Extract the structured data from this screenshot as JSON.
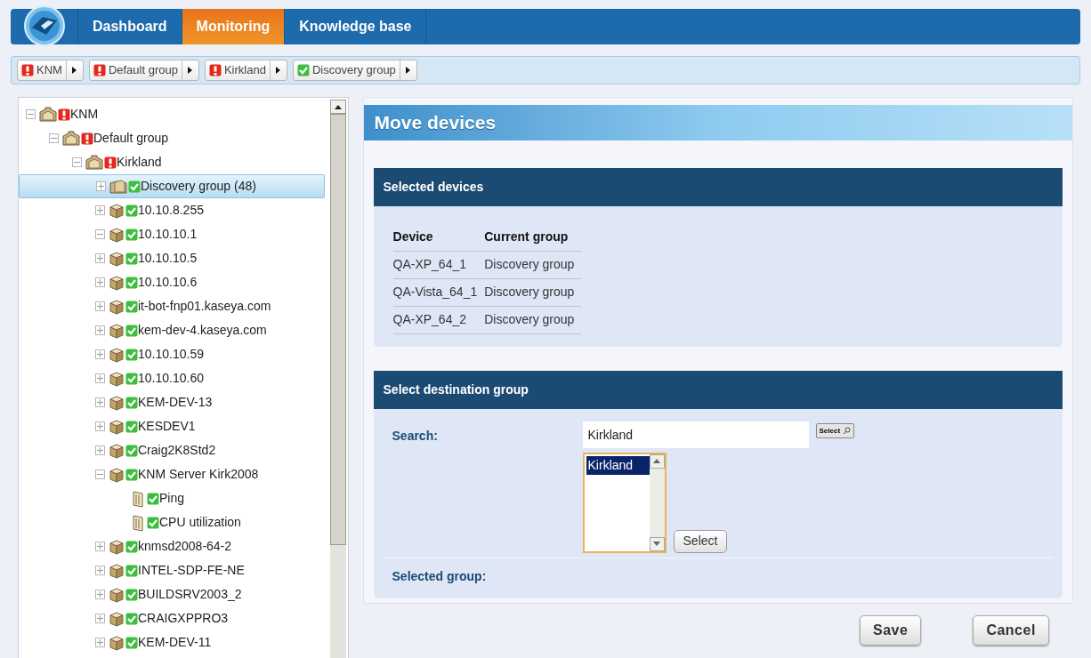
{
  "nav": {
    "tabs": [
      {
        "label": "Dashboard",
        "selected": false
      },
      {
        "label": "Monitoring",
        "selected": true
      },
      {
        "label": "Knowledge base",
        "selected": false
      }
    ]
  },
  "breadcrumb": [
    {
      "label": "KNM",
      "alert": true
    },
    {
      "label": "Default group",
      "alert": true
    },
    {
      "label": "Kirkland",
      "alert": true
    },
    {
      "label": "Discovery group",
      "alert": false
    }
  ],
  "tree": [
    {
      "label": "KNM",
      "kind": "group",
      "alert": true,
      "expanded": true,
      "selected": false,
      "children": [
        {
          "label": "Default group",
          "kind": "group",
          "alert": true,
          "expanded": true,
          "selected": false,
          "children": [
            {
              "label": "Kirkland",
              "kind": "group",
              "alert": true,
              "expanded": true,
              "selected": false,
              "children": [
                {
                  "label": "Discovery group (48)",
                  "kind": "folder",
                  "alert": false,
                  "expanded": false,
                  "selected": true
                },
                {
                  "label": "10.10.8.255",
                  "kind": "device",
                  "alert": false,
                  "expanded": false,
                  "selected": false
                },
                {
                  "label": "10.10.10.1",
                  "kind": "device",
                  "alert": false,
                  "expanded": true,
                  "selected": false
                },
                {
                  "label": "10.10.10.5",
                  "kind": "device",
                  "alert": false,
                  "expanded": false,
                  "selected": false
                },
                {
                  "label": "10.10.10.6",
                  "kind": "device",
                  "alert": false,
                  "expanded": false,
                  "selected": false
                },
                {
                  "label": "it-bot-fnp01.kaseya.com",
                  "kind": "device",
                  "alert": false,
                  "expanded": false,
                  "selected": false
                },
                {
                  "label": "kem-dev-4.kaseya.com",
                  "kind": "device",
                  "alert": false,
                  "expanded": false,
                  "selected": false
                },
                {
                  "label": "10.10.10.59",
                  "kind": "device",
                  "alert": false,
                  "expanded": false,
                  "selected": false
                },
                {
                  "label": "10.10.10.60",
                  "kind": "device",
                  "alert": false,
                  "expanded": false,
                  "selected": false
                },
                {
                  "label": "KEM-DEV-13",
                  "kind": "device",
                  "alert": false,
                  "expanded": false,
                  "selected": false
                },
                {
                  "label": "KESDEV1",
                  "kind": "device",
                  "alert": false,
                  "expanded": false,
                  "selected": false
                },
                {
                  "label": "Craig2K8Std2",
                  "kind": "device",
                  "alert": false,
                  "expanded": false,
                  "selected": false
                },
                {
                  "label": "KNM Server Kirk2008",
                  "kind": "device",
                  "alert": false,
                  "expanded": true,
                  "selected": false,
                  "children": [
                    {
                      "label": "Ping",
                      "kind": "monitor",
                      "alert": false,
                      "selected": false
                    },
                    {
                      "label": "CPU utilization",
                      "kind": "monitor",
                      "alert": false,
                      "selected": false
                    }
                  ]
                },
                {
                  "label": "knmsd2008-64-2",
                  "kind": "device",
                  "alert": false,
                  "expanded": false,
                  "selected": false
                },
                {
                  "label": "INTEL-SDP-FE-NE",
                  "kind": "device",
                  "alert": false,
                  "expanded": false,
                  "selected": false
                },
                {
                  "label": "BUILDSRV2003_2",
                  "kind": "device",
                  "alert": false,
                  "expanded": false,
                  "selected": false
                },
                {
                  "label": "CRAIGXPPRO3",
                  "kind": "device",
                  "alert": false,
                  "expanded": false,
                  "selected": false
                },
                {
                  "label": "KEM-DEV-11",
                  "kind": "device",
                  "alert": false,
                  "expanded": false,
                  "selected": false
                }
              ]
            }
          ]
        }
      ]
    }
  ],
  "dialog": {
    "title": "Move devices",
    "selected_devices": {
      "title": "Selected devices",
      "columns": [
        "Device",
        "Current group"
      ],
      "rows": [
        [
          "QA-XP_64_1",
          "Discovery group"
        ],
        [
          "QA-Vista_64_1",
          "Discovery group"
        ],
        [
          "QA-XP_64_2",
          "Discovery group"
        ]
      ]
    },
    "destination": {
      "title": "Select destination group",
      "search_label": "Search:",
      "search_value": "Kirkland",
      "search_button": "Select",
      "results": [
        {
          "label": "Kirkland",
          "selected": true
        }
      ],
      "select_button": "Select",
      "selected_group_label": "Selected group:"
    },
    "buttons": [
      "Save",
      "Cancel"
    ]
  }
}
